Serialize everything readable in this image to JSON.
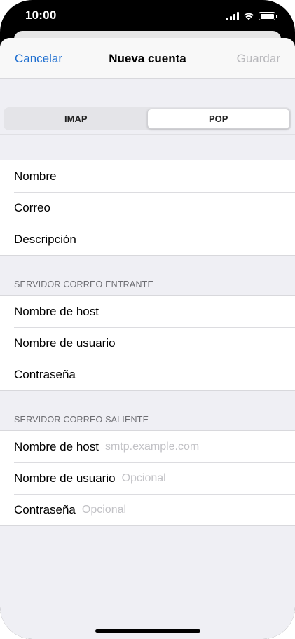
{
  "status_bar": {
    "time": "10:00",
    "signal_icon": "cellular-signal-icon",
    "wifi_icon": "wifi-icon",
    "battery_icon": "battery-icon"
  },
  "nav": {
    "cancel_label": "Cancelar",
    "title": "Nueva cuenta",
    "save_label": "Guardar"
  },
  "segmented": {
    "options": [
      "IMAP",
      "POP"
    ],
    "selected": "POP"
  },
  "account": {
    "rows": [
      {
        "label": "Nombre",
        "placeholder": ""
      },
      {
        "label": "Correo",
        "placeholder": ""
      },
      {
        "label": "Descripción",
        "placeholder": ""
      }
    ]
  },
  "incoming": {
    "header": "SERVIDOR CORREO ENTRANTE",
    "rows": [
      {
        "label": "Nombre de host",
        "placeholder": ""
      },
      {
        "label": "Nombre de usuario",
        "placeholder": ""
      },
      {
        "label": "Contraseña",
        "placeholder": ""
      }
    ]
  },
  "outgoing": {
    "header": "SERVIDOR CORREO SALIENTE",
    "rows": [
      {
        "label": "Nombre de host",
        "placeholder": "smtp.example.com"
      },
      {
        "label": "Nombre de usuario",
        "placeholder": "Opcional"
      },
      {
        "label": "Contraseña",
        "placeholder": "Opcional"
      }
    ]
  },
  "colors": {
    "accent": "#1f6fd0",
    "disabled": "#b8b8bc",
    "background": "#efeff4"
  }
}
